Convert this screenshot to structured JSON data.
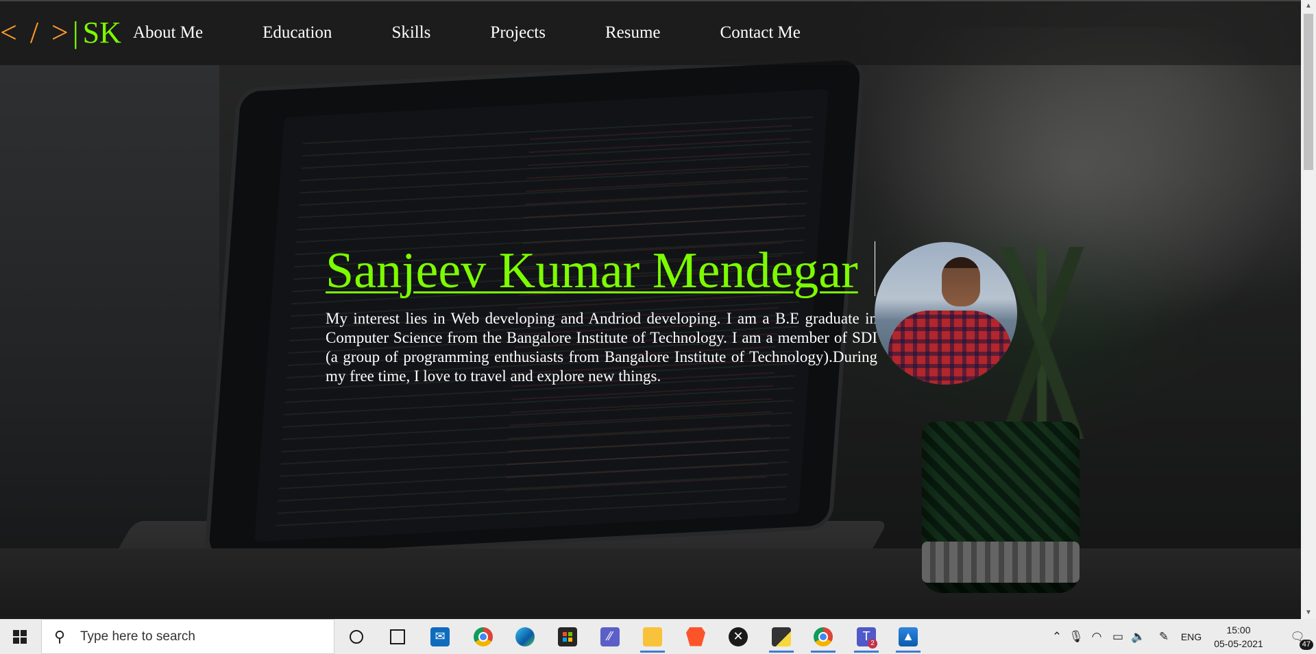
{
  "site": {
    "logo": {
      "brackets": "< / >",
      "separator": "|",
      "initials": "SK"
    },
    "nav": [
      {
        "label": "About Me"
      },
      {
        "label": "Education"
      },
      {
        "label": "Skills"
      },
      {
        "label": "Projects"
      },
      {
        "label": "Resume"
      },
      {
        "label": "Contact Me"
      }
    ],
    "hero": {
      "name": "Sanjeev Kumar Mendegar",
      "bio": "My interest lies in Web developing and Andriod developing. I am a B.E graduate in Computer Science from the Bangalore Institute of Technology. I am a member of SDI (a group of programming enthusiasts from Bangalore Institute of Technology).During my free time, I love to travel and explore new things."
    },
    "colors": {
      "accent": "#7cfc00",
      "logo_brackets": "#ff9a2e",
      "nav_text": "#ffffff"
    }
  },
  "taskbar": {
    "search_placeholder": "Type here to search",
    "apps": [
      "cortana",
      "task-view",
      "mail",
      "chrome",
      "edge",
      "store",
      "powerapps",
      "file-explorer",
      "brave",
      "xbox",
      "sticky-notes",
      "chrome-active",
      "teams",
      "photos"
    ],
    "teams_badge": "2",
    "language": "ENG",
    "time": "15:00",
    "date": "05-05-2021",
    "notification_count": "47"
  }
}
